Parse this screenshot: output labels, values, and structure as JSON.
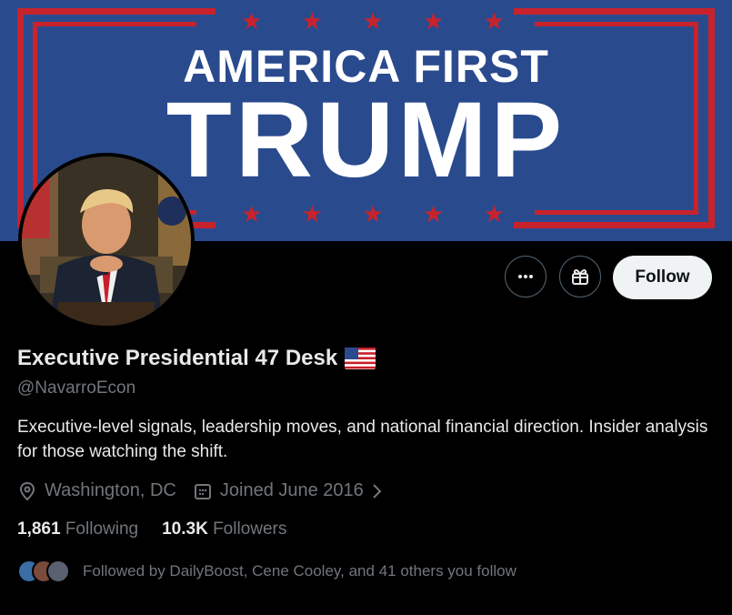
{
  "banner": {
    "line1": "AMERICA FIRST",
    "line2": "TRUMP",
    "colors": {
      "blue": "#2a4a8e",
      "red": "#c8232c",
      "white": "#ffffff"
    }
  },
  "profile": {
    "name": "Executive Presidential 47 Desk",
    "flag_icon": "us-flag-emoji",
    "handle": "@NavarroEcon",
    "bio": "Executive-level signals, leadership moves, and national financial direction. Insider analysis for those watching the shift.",
    "location": "Washington, DC",
    "joined": "Joined June 2016",
    "following_count": "1,861",
    "following_label": "Following",
    "followers_count": "10.3K",
    "followers_label": "Followers",
    "followed_by": "Followed by DailyBoost, Cene Cooley, and 41 others you follow"
  },
  "actions": {
    "more_icon": "more-horizontal-icon",
    "subscribe_icon": "gift-icon",
    "follow_label": "Follow"
  }
}
